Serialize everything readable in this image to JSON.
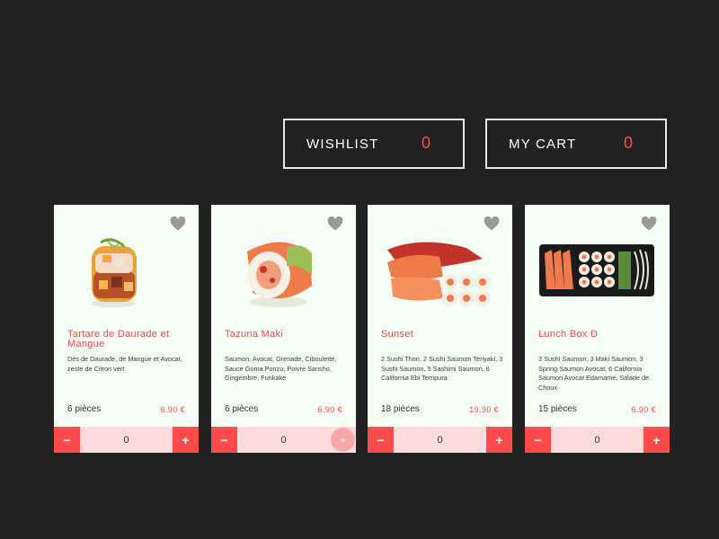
{
  "header": {
    "wishlist": {
      "label": "WISHLIST",
      "count": "0"
    },
    "cart": {
      "label": "MY CART",
      "count": "0"
    }
  },
  "products": [
    {
      "title": "Tartare de Daurade et Mangue",
      "description": "Dés de Daurade, de Mangue et Avocat, zeste de Citron vert",
      "pieces": "6 pièces",
      "price": "6.90 €",
      "quantity": "0",
      "minus": "−",
      "plus": "+"
    },
    {
      "title": "Tazuna Maki",
      "description": "Saumon, Avocat, Grenade, Ciboulette, Sauce Goma Ponzu, Poivre Sansho, Gingembre, Furikake",
      "pieces": "6 pièces",
      "price": "6.90 €",
      "quantity": "0",
      "minus": "−",
      "plus": "+"
    },
    {
      "title": "Sunset",
      "description": "2 Sushi Thon, 2 Sushi Saumon Teriyaki, 3 Sushi Saumon, 5 Sashimi Saumon, 6 California Ebi Tempura",
      "pieces": "18 pièces",
      "price": "19.90 €",
      "quantity": "0",
      "minus": "−",
      "plus": "+"
    },
    {
      "title": "Lunch Box D",
      "description": "3 Sushi Saumon, 3 Maki Saumon, 3 Spring Saumon Avocat, 6 California Saumon Avocat Edamame, Salade de Choux",
      "pieces": "15 pièces",
      "price": "6.90 €",
      "quantity": "0",
      "minus": "−",
      "plus": "+"
    }
  ],
  "colors": {
    "background": "#222222",
    "accent": "#ff4b4b",
    "card": "#f6fff6",
    "qty_bg": "#ffdcdc",
    "heart": "#9a9a9a"
  },
  "icons": {
    "heart": "heart-icon",
    "minus": "minus-icon",
    "plus": "plus-icon"
  }
}
